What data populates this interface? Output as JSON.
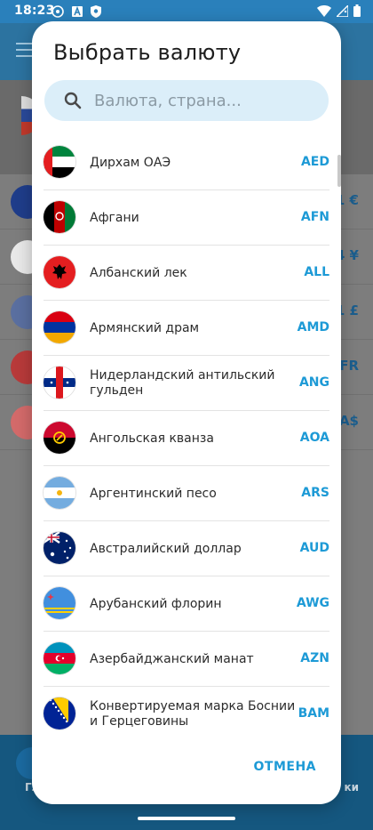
{
  "status_bar": {
    "time": "18:23"
  },
  "background": {
    "visible_values": [
      "1 €",
      "4 ¥",
      "1 £",
      "FR",
      "A$"
    ],
    "bottom_nav_left": "Гл",
    "bottom_nav_right": "ки"
  },
  "dialog": {
    "title": "Выбрать валюту",
    "search_placeholder": "Валюта, страна...",
    "cancel_label": "ОТМЕНА",
    "currencies": [
      {
        "name": "Дирхам ОАЭ",
        "code": "AED",
        "flag": "ae"
      },
      {
        "name": "Афгани",
        "code": "AFN",
        "flag": "af"
      },
      {
        "name": "Албанский лек",
        "code": "ALL",
        "flag": "al"
      },
      {
        "name": "Армянский драм",
        "code": "AMD",
        "flag": "am"
      },
      {
        "name": "Нидерландский антильский гульден",
        "code": "ANG",
        "flag": "an"
      },
      {
        "name": "Ангольская кванза",
        "code": "AOA",
        "flag": "ao"
      },
      {
        "name": "Аргентинский песо",
        "code": "ARS",
        "flag": "ar"
      },
      {
        "name": "Австралийский доллар",
        "code": "AUD",
        "flag": "au"
      },
      {
        "name": "Арубанский флорин",
        "code": "AWG",
        "flag": "aw"
      },
      {
        "name": "Азербайджанский манат",
        "code": "AZN",
        "flag": "az"
      },
      {
        "name": "Конвертируемая марка Боснии и Герцеговины",
        "code": "BAM",
        "flag": "ba"
      }
    ]
  }
}
